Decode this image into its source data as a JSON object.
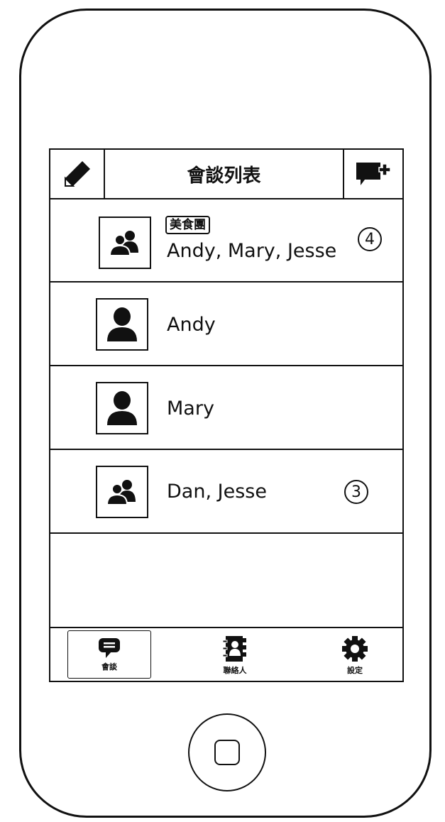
{
  "header": {
    "title": "會談列表",
    "left_icon": "pencil-icon",
    "right_icon": "new-chat-icon"
  },
  "conversations": [
    {
      "tag": "美食團",
      "name": "Andy, Mary, Jesse",
      "badge": "4",
      "avatar": "group-icon"
    },
    {
      "name": "Andy",
      "avatar": "person-icon"
    },
    {
      "name": "Mary",
      "avatar": "person-icon"
    },
    {
      "name": "Dan, Jesse",
      "badge": "3",
      "avatar": "group-icon"
    }
  ],
  "tabs": [
    {
      "label": "會談",
      "icon": "chat-bubble-icon",
      "active": true
    },
    {
      "label": "聯絡人",
      "icon": "contacts-book-icon",
      "active": false
    },
    {
      "label": "設定",
      "icon": "gear-icon",
      "active": false
    }
  ]
}
